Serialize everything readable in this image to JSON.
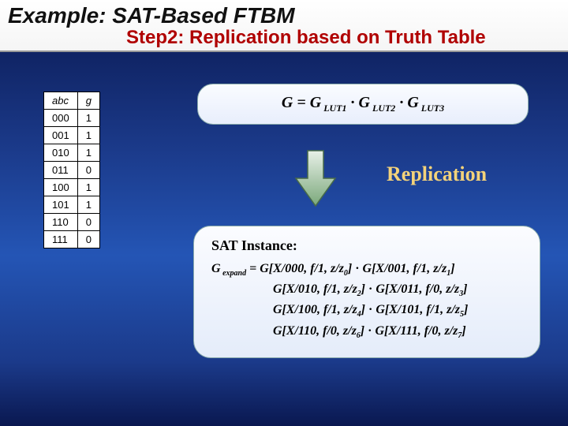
{
  "title": "Example: SAT-Based FTBM",
  "subtitle": "Step2: Replication based on Truth Table",
  "table": {
    "head_a": "abc",
    "head_b": "g",
    "rows": [
      {
        "k": "000",
        "v": "1"
      },
      {
        "k": "001",
        "v": "1"
      },
      {
        "k": "010",
        "v": "1"
      },
      {
        "k": "011",
        "v": "0"
      },
      {
        "k": "100",
        "v": "1"
      },
      {
        "k": "101",
        "v": "1"
      },
      {
        "k": "110",
        "v": "0"
      },
      {
        "k": "111",
        "v": "0"
      }
    ]
  },
  "formula": {
    "lhs": "G = G",
    "s1": " LUT1",
    "mid1": " · G",
    "s2": " LUT2",
    "mid2": "  · G",
    "s3": " LUT3"
  },
  "replication_label": "Replication",
  "sat": {
    "title": "SAT Instance:",
    "lhs": "G",
    "lhs_sub": " expand",
    "eq": " = ",
    "dot": " · ",
    "t0a": "G[X/000, f/1, z/z",
    "t0s": "0",
    "t0c": "]",
    "t1a": "G[X/001, f/1, z/z",
    "t1s": "1",
    "t1c": "]",
    "t2a": "G[X/010, f/1, z/z",
    "t2s": "2",
    "t2c": "]",
    "t3a": "G[X/011, f/0, z/z",
    "t3s": "3",
    "t3c": "]",
    "t4a": "G[X/100, f/1, z/z",
    "t4s": "4",
    "t4c": "]",
    "t5a": "G[X/101, f/1, z/z",
    "t5s": "5",
    "t5c": "]",
    "t6a": "G[X/110, f/0, z/z",
    "t6s": "6",
    "t6c": "]",
    "t7a": "G[X/111, f/0, z/z",
    "t7s": "7",
    "t7c": "]"
  }
}
